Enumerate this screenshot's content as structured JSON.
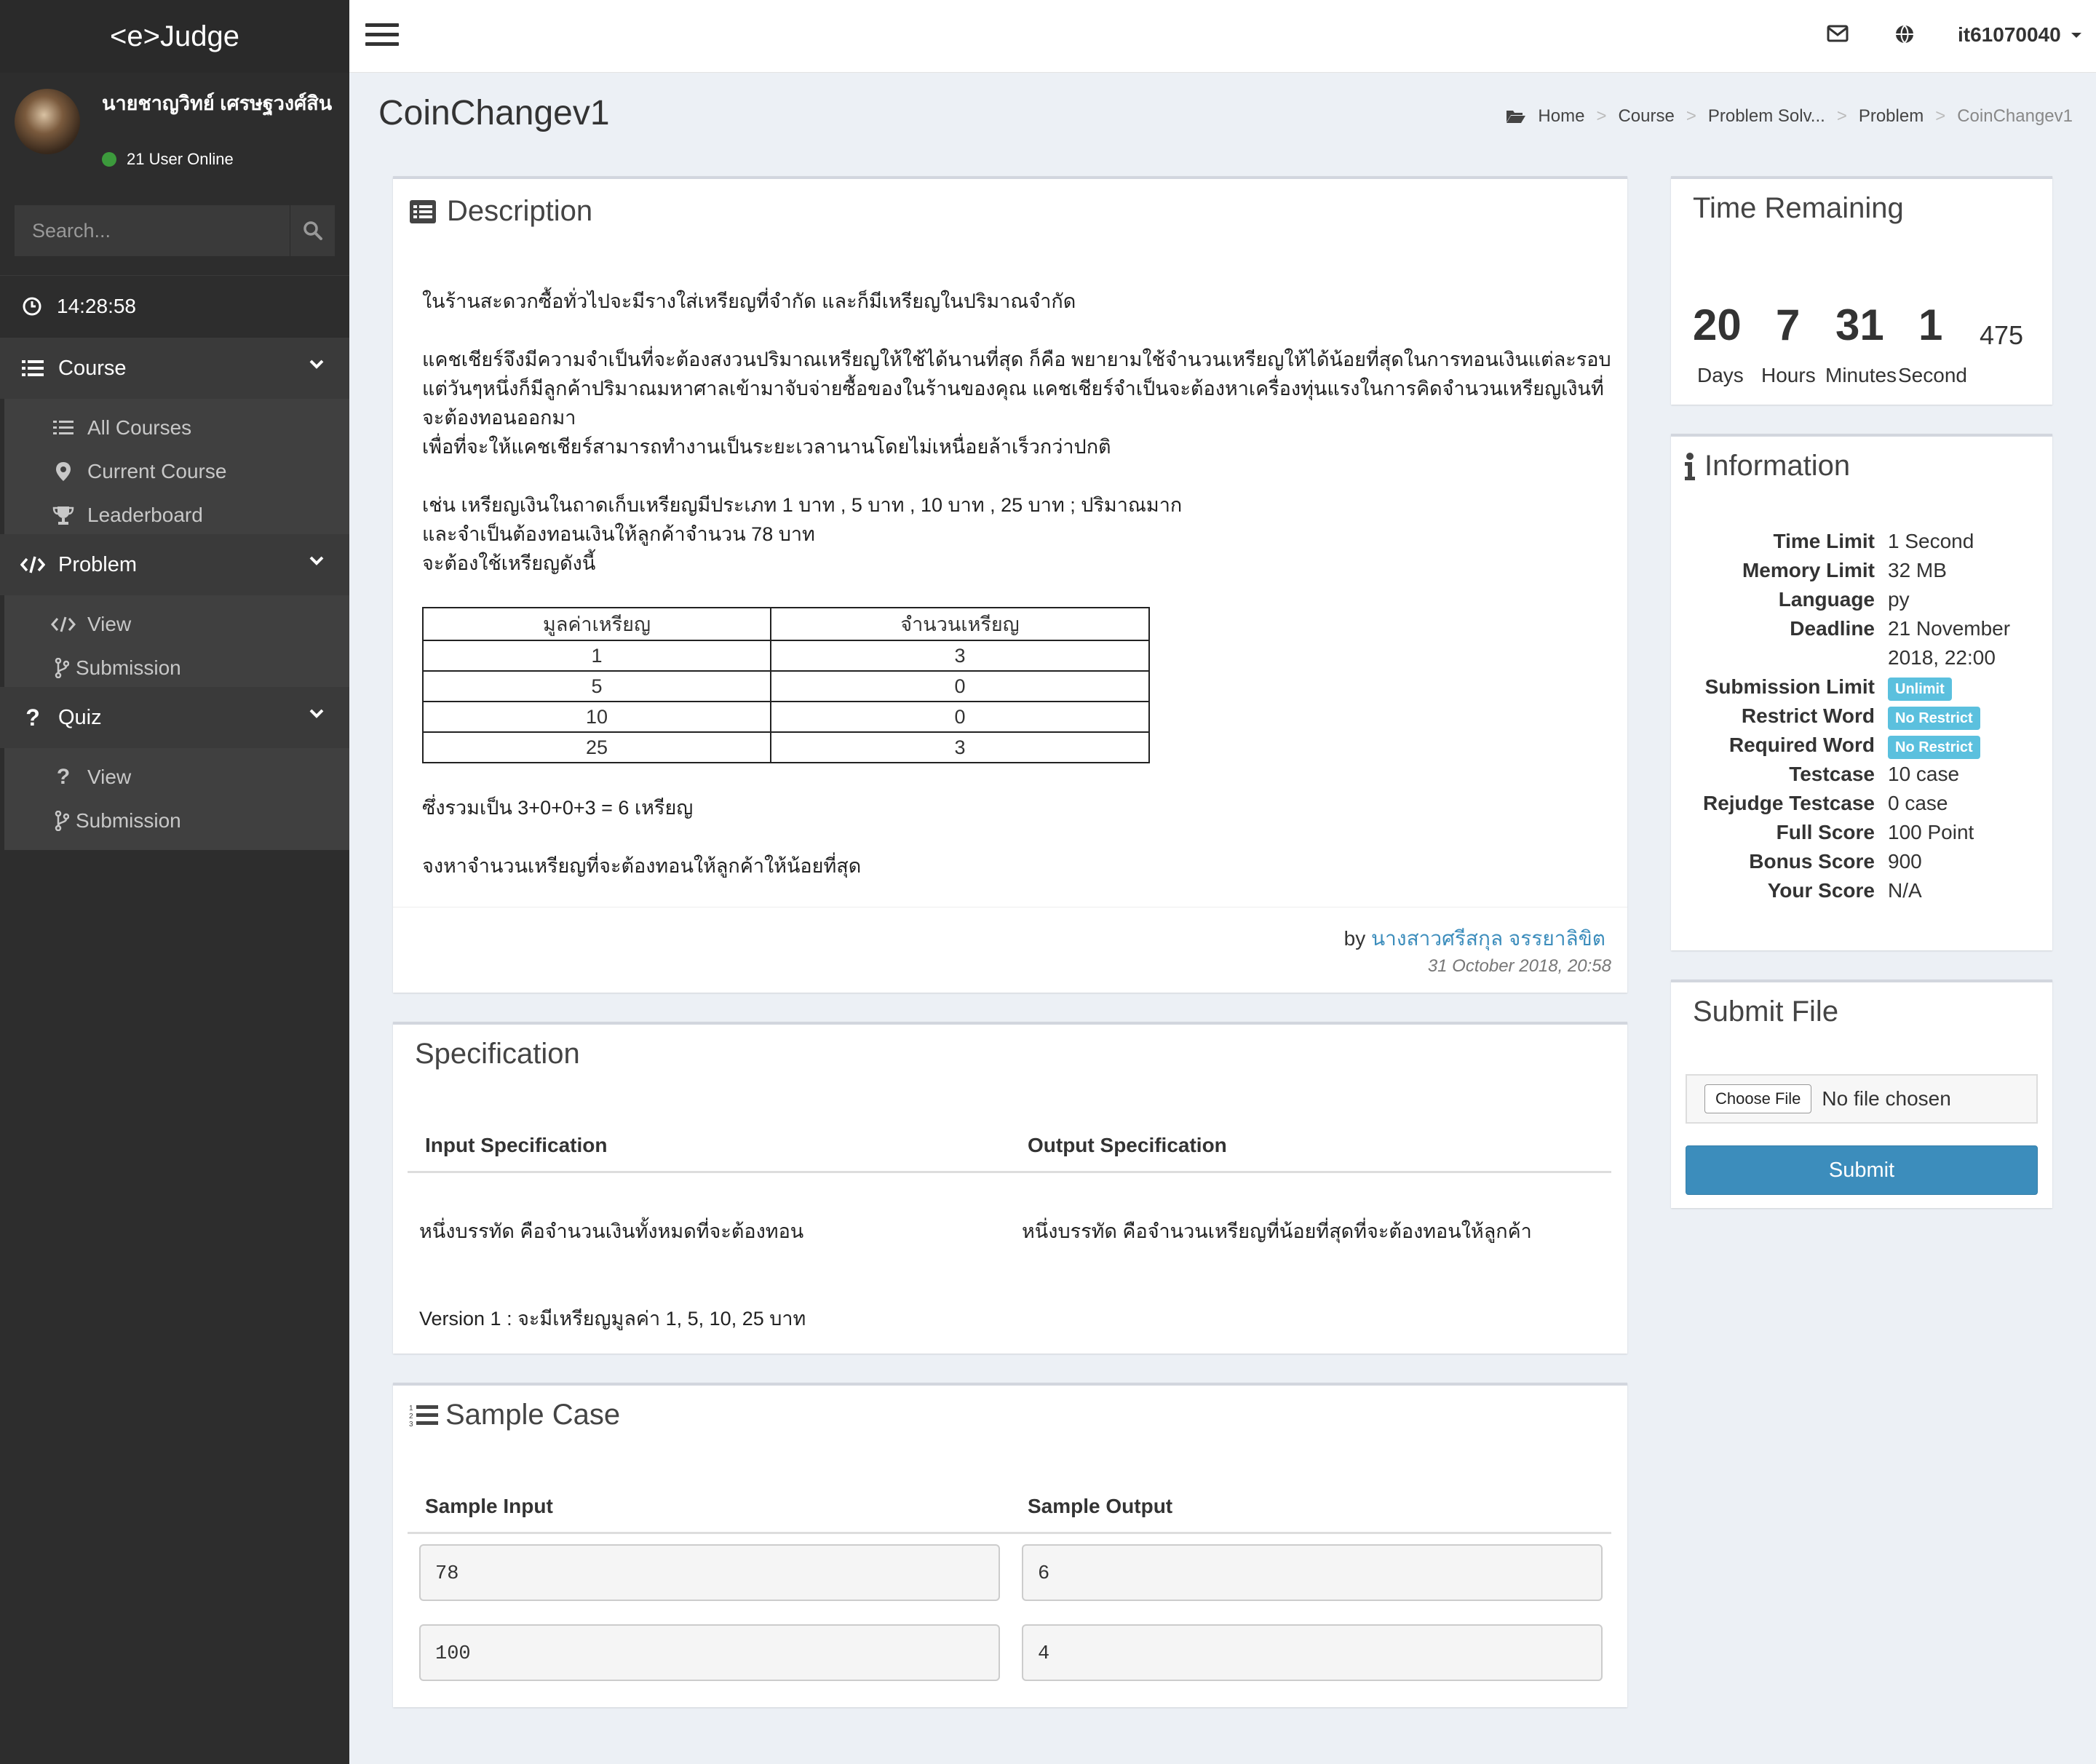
{
  "sidebar": {
    "logo": "<e>Judge",
    "user_name": "นายชาญวิทย์ เศรษฐวงศ์สิน",
    "online": "21 User Online",
    "search_placeholder": "Search...",
    "clock": "14:28:58",
    "course": {
      "label": "Course",
      "items": [
        "All Courses",
        "Current Course",
        "Leaderboard"
      ]
    },
    "problem": {
      "label": "Problem",
      "items": [
        "View",
        "Submission"
      ]
    },
    "quiz": {
      "label": "Quiz",
      "items": [
        "View",
        "Submission"
      ]
    }
  },
  "topbar": {
    "username": "it61070040"
  },
  "page": {
    "title": "CoinChangev1",
    "breadcrumb": [
      "Home",
      "Course",
      "Problem Solv...",
      "Problem",
      "CoinChangev1"
    ]
  },
  "description": {
    "title": "Description",
    "paragraphs": [
      "ในร้านสะดวกซื้อทั่วไปจะมีรางใส่เหรียญที่จำกัด และก็มีเหรียญในปริมาณจำกัด",
      "แคชเชียร์จึงมีความจำเป็นที่จะต้องสงวนปริมาณเหรียญให้ใช้ได้นานที่สุด ก็คือ พยายามใช้จำนวนเหรียญให้ได้น้อยที่สุดในการทอนเงินแต่ละรอบ แต่วันๆหนึ่งก็มีลูกค้าปริมาณมหาศาลเข้ามาจับจ่ายซื้อของในร้านของคุณ แคชเชียร์จำเป็นจะต้องหาเครื่องทุ่นแรงในการคิดจำนวนเหรียญเงินที่จะต้องทอนออกมา",
      "เพื่อที่จะให้แคชเชียร์สามารถทำงานเป็นระยะเวลานานโดยไม่เหนื่อยล้าเร็วกว่าปกติ",
      "เช่น เหรียญเงินในถาดเก็บเหรียญมีประเภท 1 บาท , 5 บาท , 10 บาท , 25 บาท ; ปริมาณมาก",
      "และจำเป็นต้องทอนเงินให้ลูกค้าจำนวน 78 บาท",
      "จะต้องใช้เหรียญดังนี้",
      "ซึ่งรวมเป็น 3+0+0+3 = 6 เหรียญ",
      "จงหาจำนวนเหรียญที่จะต้องทอนให้ลูกค้าให้น้อยที่สุด"
    ],
    "table": {
      "headers": [
        "มูลค่าเหรียญ",
        "จำนวนเหรียญ"
      ],
      "rows": [
        [
          "1",
          "3"
        ],
        [
          "5",
          "0"
        ],
        [
          "10",
          "0"
        ],
        [
          "25",
          "3"
        ]
      ]
    },
    "by_label": "by",
    "author": "นางสาวศรีสกุล จรรยาลิขิต",
    "date": "31 October 2018, 20:58"
  },
  "specification": {
    "title": "Specification",
    "input_head": "Input Specification",
    "output_head": "Output Specification",
    "input_text": "หนึ่งบรรทัด คือจำนวนเงินทั้งหมดที่จะต้องทอน",
    "output_text": "หนึ่งบรรทัด คือจำนวนเหรียญที่น้อยที่สุดที่จะต้องทอนให้ลูกค้า",
    "version_note": "Version 1 : จะมีเหรียญมูลค่า 1, 5, 10, 25 บาท"
  },
  "sample": {
    "title": "Sample Case",
    "input_head": "Sample Input",
    "output_head": "Sample Output",
    "cases": [
      {
        "input": "78",
        "output": "6"
      },
      {
        "input": "100",
        "output": "4"
      }
    ]
  },
  "time_remaining": {
    "title": "Time Remaining",
    "days": "20",
    "hours": "7",
    "minutes": "31",
    "seconds": "1",
    "ms": "475",
    "labels": [
      "Days",
      "Hours",
      "Minutes",
      "Second"
    ]
  },
  "information": {
    "title": "Information",
    "rows": [
      {
        "k": "Time Limit",
        "v": "1 Second"
      },
      {
        "k": "Memory Limit",
        "v": "32 MB"
      },
      {
        "k": "Language",
        "v": "py"
      },
      {
        "k": "Deadline",
        "v": "21 November 2018, 22:00"
      },
      {
        "k": "Submission Limit",
        "v": "Unlimit"
      },
      {
        "k": "Restrict Word",
        "v": "No Restrict"
      },
      {
        "k": "Required Word",
        "v": "No Restrict"
      },
      {
        "k": "Testcase",
        "v": "10 case"
      },
      {
        "k": "Rejudge Testcase",
        "v": "0 case"
      },
      {
        "k": "Full Score",
        "v": "100 Point"
      },
      {
        "k": "Bonus Score",
        "v": "900"
      },
      {
        "k": "Your Score",
        "v": "N/A"
      }
    ]
  },
  "submit": {
    "title": "Submit File",
    "choose_label": "Choose File",
    "file_status": "No file chosen",
    "submit_label": "Submit"
  },
  "colors": {
    "sidebar_bg": "#2d2d2d",
    "accent": "#3c8dbc",
    "badge": "#5bc0de",
    "online": "#3c9a3c"
  }
}
